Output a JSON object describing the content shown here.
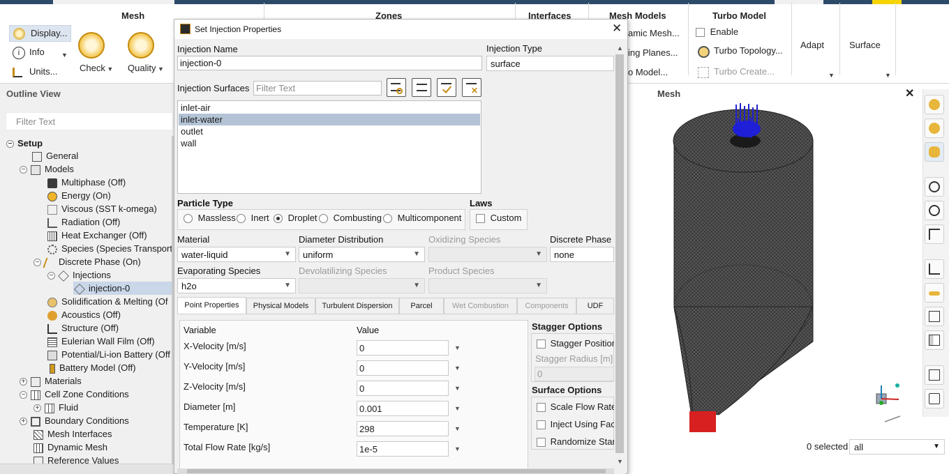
{
  "ribbon": {
    "groups": {
      "mesh": "Mesh",
      "zones": "Zones",
      "interfaces": "Interfaces",
      "mesh_models": "Mesh Models",
      "turbo_model": "Turbo Model"
    },
    "mesh_items": {
      "display": "Display...",
      "info": "Info",
      "units": "Units...",
      "check": "Check",
      "quality": "Quality"
    },
    "mesh_models_items": [
      "amic Mesh...",
      "ing Planes...",
      "o Model..."
    ],
    "turbo_items": {
      "enable": "Enable",
      "topology": "Turbo Topology...",
      "create": "Turbo Create..."
    },
    "adapt": "Adapt",
    "surface": "Surface"
  },
  "outline": {
    "title": "Outline View",
    "filter_placeholder": "Filter Text",
    "items": [
      {
        "label": "Setup",
        "bold": true
      },
      {
        "label": "General"
      },
      {
        "label": "Models"
      },
      {
        "label": "Multiphase (Off)"
      },
      {
        "label": "Energy (On)"
      },
      {
        "label": "Viscous (SST k-omega)"
      },
      {
        "label": "Radiation (Off)"
      },
      {
        "label": "Heat Exchanger (Off)"
      },
      {
        "label": "Species (Species Transport"
      },
      {
        "label": "Discrete Phase (On)"
      },
      {
        "label": "Injections"
      },
      {
        "label": "injection-0"
      },
      {
        "label": "Solidification & Melting (Of"
      },
      {
        "label": "Acoustics (Off)"
      },
      {
        "label": "Structure (Off)"
      },
      {
        "label": "Eulerian Wall Film (Off)"
      },
      {
        "label": "Potential/Li-ion Battery (Off"
      },
      {
        "label": "Battery Model (Off)"
      },
      {
        "label": "Materials"
      },
      {
        "label": "Cell Zone Conditions"
      },
      {
        "label": "Fluid"
      },
      {
        "label": "Boundary Conditions"
      },
      {
        "label": "Mesh Interfaces"
      },
      {
        "label": "Dynamic Mesh"
      },
      {
        "label": "Reference Values"
      }
    ]
  },
  "graphics": {
    "title": "Mesh",
    "selected_label": "0 selected",
    "selection_filter": "all"
  },
  "dialog": {
    "title": "Set Injection Properties",
    "injection_name_label": "Injection Name",
    "injection_name": "injection-0",
    "injection_type_label": "Injection Type",
    "injection_type": "surface",
    "surfaces_label": "Injection Surfaces",
    "surfaces_filter_placeholder": "Filter Text",
    "surfaces": [
      "inlet-air",
      "inlet-water",
      "outlet",
      "wall"
    ],
    "selected_surface": "inlet-water",
    "particle_type_label": "Particle Type",
    "particle_types": [
      "Massless",
      "Inert",
      "Droplet",
      "Combusting",
      "Multicomponent"
    ],
    "particle_type_selected": "Droplet",
    "laws_label": "Laws",
    "laws_custom": "Custom",
    "material_label": "Material",
    "material": "water-liquid",
    "diameter_dist_label": "Diameter Distribution",
    "diameter_dist": "uniform",
    "oxidizing_label": "Oxidizing Species",
    "discrete_phase_label": "Discrete Phase D",
    "discrete_phase": "none",
    "evaporating_label": "Evaporating Species",
    "evaporating": "h2o",
    "devolatilizing_label": "Devolatilizing Species",
    "product_label": "Product Species",
    "tabs": [
      "Point Properties",
      "Physical Models",
      "Turbulent Dispersion",
      "Parcel",
      "Wet Combustion",
      "Components",
      "UDF"
    ],
    "active_tab": "Point Properties",
    "var_header": "Variable",
    "value_header": "Value",
    "variables": [
      {
        "name": "X-Velocity [m/s]",
        "value": "0"
      },
      {
        "name": "Y-Velocity [m/s]",
        "value": "0"
      },
      {
        "name": "Z-Velocity [m/s]",
        "value": "0"
      },
      {
        "name": "Diameter [m]",
        "value": "0.001"
      },
      {
        "name": "Temperature [K]",
        "value": "298"
      },
      {
        "name": "Total Flow Rate [kg/s]",
        "value": "1e-5"
      }
    ],
    "stagger_options_label": "Stagger Options",
    "stagger_positions": "Stagger Position",
    "stagger_radius_label": "Stagger Radius [m]",
    "stagger_radius": "0",
    "surface_options_label": "Surface Options",
    "scale_flow_rate": "Scale Flow Rate",
    "inject_using_face": "Inject Using Face",
    "randomize_start": "Randomize Star"
  }
}
